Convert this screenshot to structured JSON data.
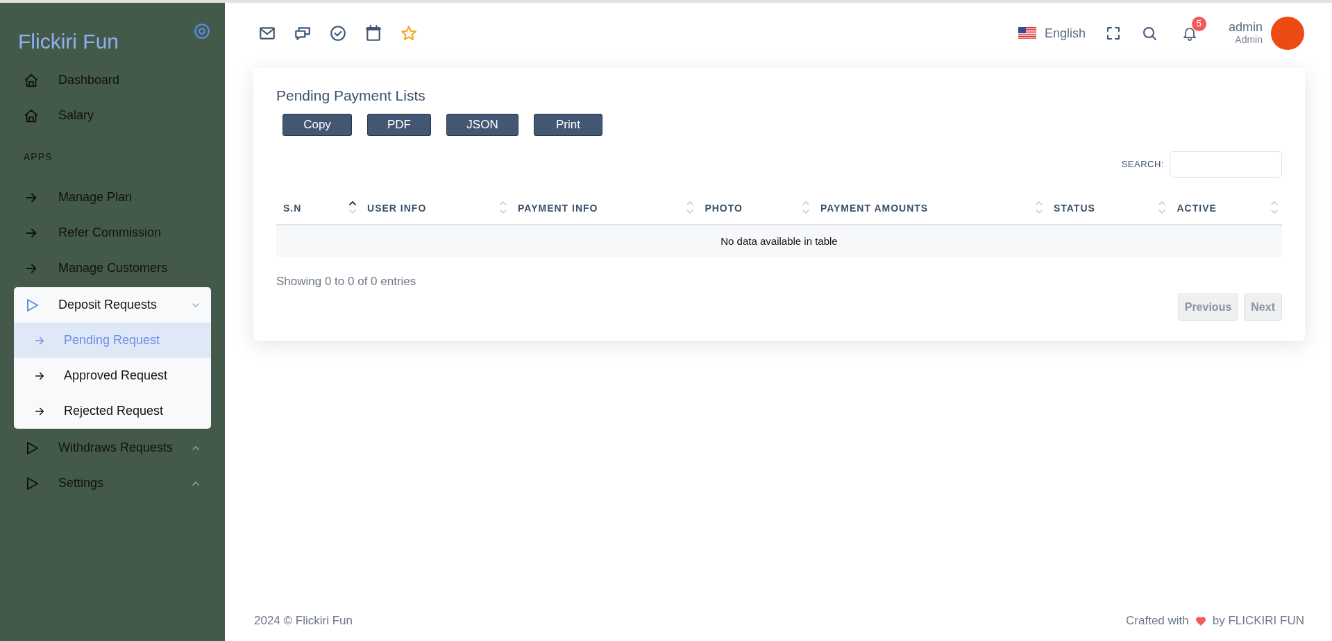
{
  "sidebar": {
    "logo": "Flickiri Fun",
    "items": [
      {
        "kind": "home",
        "label": "Dashboard"
      },
      {
        "kind": "home",
        "label": "Salary"
      },
      {
        "kind": "section",
        "label": "APPS"
      },
      {
        "kind": "arrow",
        "label": "Manage Plan"
      },
      {
        "kind": "arrow",
        "label": "Refer Commission"
      },
      {
        "kind": "arrow",
        "label": "Manage Customers"
      },
      {
        "kind": "group",
        "label": "Deposit Requests",
        "expanded": true,
        "children": [
          {
            "label": "Pending Request",
            "selected": true
          },
          {
            "label": "Approved Request",
            "selected": false
          },
          {
            "label": "Rejected Request",
            "selected": false
          }
        ]
      },
      {
        "kind": "group",
        "label": "Withdraws Requests",
        "expanded": false
      },
      {
        "kind": "group",
        "label": "Settings",
        "expanded": false
      }
    ]
  },
  "header": {
    "language": "English",
    "notification_count": "5",
    "user_name": "admin",
    "user_role": "Admin"
  },
  "card": {
    "title": "Pending Payment Lists",
    "buttons": [
      "Copy",
      "PDF",
      "JSON",
      "Print"
    ],
    "search_label": "SEARCH:",
    "table": {
      "columns": [
        {
          "label": "S.N",
          "sorted": true
        },
        {
          "label": "USER INFO",
          "sorted": false
        },
        {
          "label": "PAYMENT INFO",
          "sorted": false
        },
        {
          "label": "PHOTO",
          "sorted": false
        },
        {
          "label": "PAYMENT AMOUNTS",
          "sorted": false
        },
        {
          "label": "STATUS",
          "sorted": false
        },
        {
          "label": "ACTIVE",
          "sorted": false
        }
      ],
      "empty_message": "No data available in table"
    },
    "info": "Showing 0 to 0 of 0 entries",
    "pagination": [
      "Previous",
      "Next"
    ]
  },
  "footer": {
    "copyright": "2024 © Flickiri Fun",
    "crafted_prefix": "Crafted with",
    "crafted_suffix": "by FLICKIRI FUN"
  }
}
